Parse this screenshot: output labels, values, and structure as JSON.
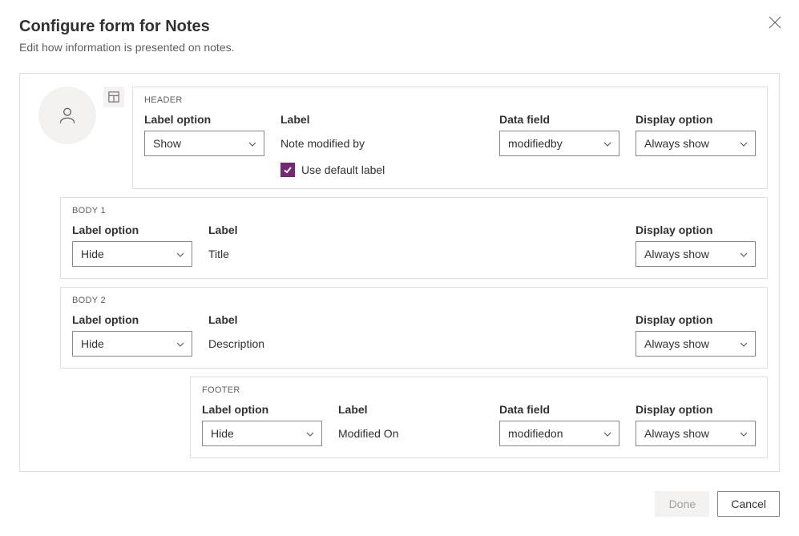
{
  "dialog": {
    "title": "Configure form for Notes",
    "subtitle": "Edit how information is presented on notes."
  },
  "labels": {
    "label_option": "Label option",
    "label": "Label",
    "data_field": "Data field",
    "display_option": "Display option",
    "use_default_label": "Use default label"
  },
  "sections": {
    "header": {
      "title": "HEADER",
      "label_option": "Show",
      "label": "Note modified by",
      "use_default_label": true,
      "data_field": "modifiedby",
      "display_option": "Always show"
    },
    "body1": {
      "title": "BODY 1",
      "label_option": "Hide",
      "label": "Title",
      "display_option": "Always show"
    },
    "body2": {
      "title": "BODY 2",
      "label_option": "Hide",
      "label": "Description",
      "display_option": "Always show"
    },
    "footer": {
      "title": "FOOTER",
      "label_option": "Hide",
      "label": "Modified On",
      "data_field": "modifiedon",
      "display_option": "Always show"
    }
  },
  "buttons": {
    "done": "Done",
    "cancel": "Cancel"
  }
}
